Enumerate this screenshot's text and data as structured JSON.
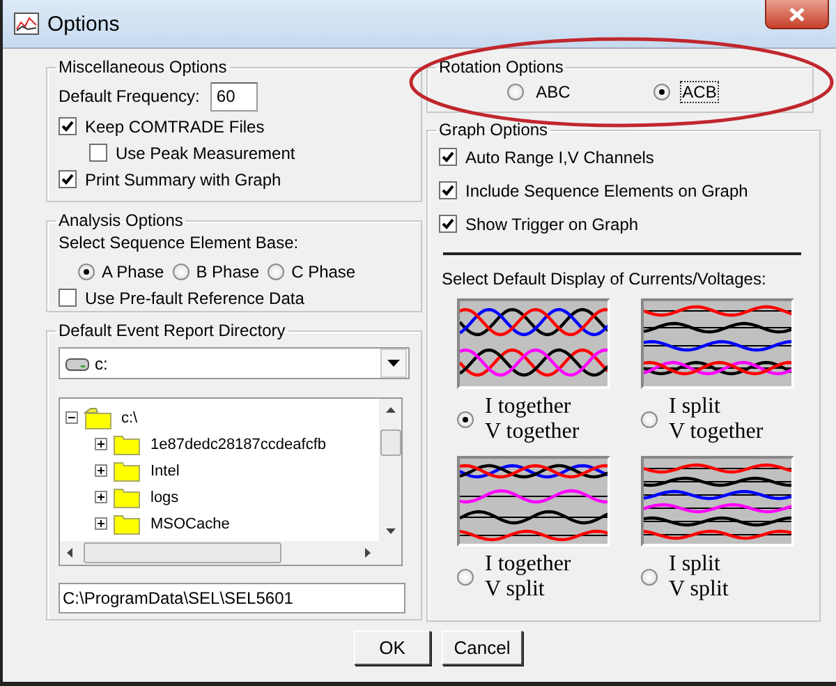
{
  "window": {
    "title": "Options"
  },
  "misc": {
    "title": "Miscellaneous Options",
    "frequency_label": "Default Frequency:",
    "frequency": "60",
    "checks": [
      {
        "label": "Keep COMTRADE Files",
        "checked": true,
        "children": [
          {
            "label": "Use Peak Measurement",
            "checked": false
          }
        ]
      },
      {
        "label": "Print Summary with Graph",
        "checked": true
      }
    ]
  },
  "analysis": {
    "title": "Analysis Options",
    "prompt": "Select Sequence Element Base:",
    "phases": [
      {
        "label": "A Phase",
        "selected": true
      },
      {
        "label": "B Phase",
        "selected": false
      },
      {
        "label": "C Phase",
        "selected": false
      }
    ],
    "checks": [
      {
        "label": "Use Pre-fault Reference Data",
        "checked": false
      }
    ]
  },
  "directory": {
    "title": "Default Event Report Directory",
    "drive": "c:",
    "tree": [
      {
        "label": "c:\\",
        "expanded": true,
        "children": [
          {
            "label": "1e87dedc28187ccdeafcfb",
            "expanded": false
          },
          {
            "label": "Intel",
            "expanded": false
          },
          {
            "label": "logs",
            "expanded": false
          },
          {
            "label": "MSOCache",
            "expanded": false
          }
        ]
      }
    ],
    "path": "C:\\ProgramData\\SEL\\SEL5601"
  },
  "rotation": {
    "title": "Rotation Options",
    "options": [
      {
        "label": "ABC",
        "selected": false,
        "focused": false
      },
      {
        "label": "ACB",
        "selected": true,
        "focused": true
      }
    ]
  },
  "graph": {
    "title": "Graph Options",
    "checks": [
      {
        "label": "Auto Range I,V Channels",
        "checked": true
      },
      {
        "label": "Include Sequence Elements on Graph",
        "checked": true
      },
      {
        "label": "Show Trigger on Graph",
        "checked": true
      }
    ],
    "display_prompt": "Select Default Display of Currents/Voltages:",
    "displays": [
      {
        "kind": "together",
        "lines": [
          "I together",
          "V together"
        ],
        "selected": true
      },
      {
        "kind": "isplit",
        "lines": [
          "I split",
          "V together"
        ],
        "selected": false
      },
      {
        "kind": "vsplit",
        "lines": [
          "I together",
          "V split"
        ],
        "selected": false
      },
      {
        "kind": "split",
        "lines": [
          "I split",
          "V split"
        ],
        "selected": false
      }
    ]
  },
  "buttons": [
    {
      "label": "OK"
    },
    {
      "label": "Cancel"
    }
  ],
  "annotations": [
    {
      "kind": "ellipse"
    }
  ]
}
